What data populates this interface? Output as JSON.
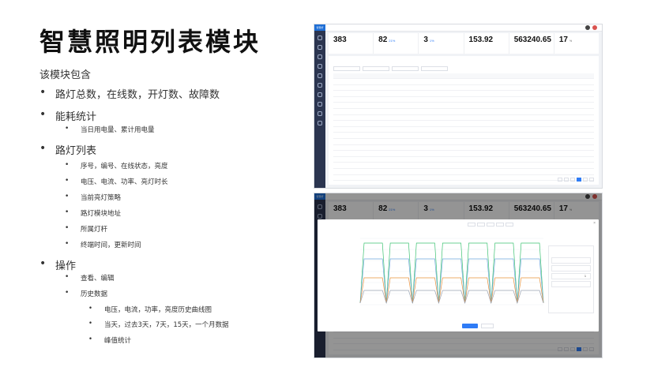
{
  "page": {
    "title": "智慧照明列表模块",
    "intro": "该模块包含"
  },
  "outline": [
    {
      "level": 1,
      "text": "路灯总数，在线数，开灯数、故障数"
    },
    {
      "level": 1,
      "text": "能耗统计"
    },
    {
      "level": 2,
      "text": "当日用电量、累计用电量"
    },
    {
      "level": 1,
      "text": "路灯列表"
    },
    {
      "level": 2,
      "text": "序号，编号、在线状态，亮度"
    },
    {
      "level": 2,
      "text": "电压、电流、功率、亮灯时长"
    },
    {
      "level": 2,
      "text": "当前亮灯策略"
    },
    {
      "level": 2,
      "text": "路灯模块地址"
    },
    {
      "level": 2,
      "text": "所属灯杆"
    },
    {
      "level": 2,
      "text": "终端时间，更新时间"
    },
    {
      "level": 1,
      "text": "操作"
    },
    {
      "level": 2,
      "text": "查看、编辑"
    },
    {
      "level": 2,
      "text": "历史数据"
    },
    {
      "level": 3,
      "text": "电压，电流，功率，亮度历史曲线图"
    },
    {
      "level": 3,
      "text": "当天，过去3天，7天，15天，一个月数据"
    },
    {
      "level": 3,
      "text": "峰值统计"
    }
  ],
  "screens": {
    "logo": "智慧杆",
    "breadcrumb": "",
    "stats": [
      {
        "value": "383",
        "pct": "",
        "unit": "",
        "label": ""
      },
      {
        "value": "82",
        "pct": "21%",
        "unit": "",
        "label": ""
      },
      {
        "value": "3",
        "pct": "1%",
        "unit": "",
        "label": ""
      },
      {
        "value": "153.92",
        "pct": "",
        "unit": "",
        "label": ""
      },
      {
        "value": "563240.65",
        "pct": "",
        "unit": "",
        "label": ""
      },
      {
        "value": "17",
        "pct": "",
        "unit": "%",
        "label": ""
      }
    ],
    "list_title": "",
    "list_time": "",
    "filters": [
      "",
      "",
      "",
      ""
    ],
    "export_label": "",
    "table": {
      "headers": [
        "",
        "",
        "",
        "",
        "",
        "",
        "",
        "",
        "",
        "",
        "",
        "",
        "",
        "",
        ""
      ],
      "rows": [
        [
          "",
          "",
          "",
          "",
          "",
          "",
          "",
          "",
          "",
          "",
          "",
          "",
          "",
          "",
          ""
        ],
        [
          "",
          "",
          "",
          "",
          "",
          "",
          "",
          "",
          "",
          "",
          "",
          "",
          "",
          "",
          ""
        ],
        [
          "",
          "",
          "",
          "",
          "",
          "",
          "",
          "",
          "",
          "",
          "",
          "",
          "",
          "",
          ""
        ],
        [
          "",
          "",
          "",
          "",
          "",
          "",
          "",
          "",
          "",
          "",
          "",
          "",
          "",
          "",
          ""
        ],
        [
          "",
          "",
          "",
          "",
          "",
          "",
          "",
          "",
          "",
          "",
          "",
          "",
          "",
          "",
          ""
        ],
        [
          "",
          "",
          "",
          "",
          "",
          "",
          "",
          "",
          "",
          "",
          "",
          "",
          "",
          "",
          ""
        ],
        [
          "",
          "",
          "",
          "",
          "",
          "",
          "",
          "",
          "",
          "",
          "",
          "",
          "",
          "",
          ""
        ],
        [
          "",
          "",
          "",
          "",
          "",
          "",
          "",
          "",
          "",
          "",
          "",
          "",
          "",
          "",
          ""
        ],
        [
          "",
          "",
          "",
          "",
          "",
          "",
          "",
          "",
          "",
          "",
          "",
          "",
          "",
          "",
          ""
        ],
        [
          "",
          "",
          "",
          "",
          "",
          "",
          "",
          "",
          "",
          "",
          "",
          "",
          "",
          "",
          ""
        ],
        [
          "",
          "",
          "",
          "",
          "",
          "",
          "",
          "",
          "",
          "",
          "",
          "",
          "",
          "",
          ""
        ],
        [
          "",
          "",
          "",
          "",
          "",
          "",
          "",
          "",
          "",
          "",
          "",
          "",
          "",
          "",
          ""
        ],
        [
          "",
          "",
          "",
          "",
          "",
          "",
          "",
          "",
          "",
          "",
          "",
          "",
          "",
          "",
          ""
        ],
        [
          "",
          "",
          "",
          "",
          "",
          "",
          "",
          "",
          "",
          "",
          "",
          "",
          "",
          "",
          ""
        ],
        [
          "",
          "",
          "",
          "",
          "",
          "",
          "",
          "",
          "",
          "",
          "",
          "",
          "",
          "",
          ""
        ],
        [
          "",
          "",
          "",
          "",
          "",
          "",
          "",
          "",
          "",
          "",
          "",
          "",
          "",
          "",
          ""
        ],
        [
          "",
          "",
          "",
          "",
          "",
          "",
          "",
          "",
          "",
          "",
          "",
          "",
          "",
          "",
          ""
        ],
        [
          "",
          "",
          "",
          "",
          "",
          "",
          "",
          "",
          "",
          "",
          "",
          "",
          "",
          "",
          ""
        ],
        [
          "",
          "",
          "",
          "",
          "",
          "",
          "",
          "",
          "",
          "",
          "",
          "",
          "",
          "",
          ""
        ],
        [
          "",
          "",
          "",
          "",
          "",
          "",
          "",
          "",
          "",
          "",
          "",
          "",
          "",
          "",
          ""
        ],
        [
          "",
          "",
          "",
          "",
          "",
          "",
          "",
          "",
          "",
          "",
          "",
          "",
          "",
          "",
          ""
        ],
        [
          "",
          "",
          "",
          "",
          "",
          "",
          "",
          "",
          "",
          "",
          "",
          "",
          "",
          "",
          ""
        ]
      ]
    },
    "pager": {
      "total": "",
      "pages": [
        "",
        "",
        "",
        "",
        "",
        ""
      ],
      "active_index": 3
    },
    "modal": {
      "title": "",
      "close": "×",
      "side_header": "",
      "side_items": [
        "",
        "",
        "",
        "",
        "",
        "",
        "",
        "",
        "",
        ""
      ],
      "range_buttons": [
        "",
        "",
        "",
        "",
        ""
      ],
      "check_label": "",
      "peaks": [
        {
          "label": "",
          "value": ""
        },
        {
          "label": "",
          "value": ""
        },
        {
          "label": "",
          "value": "1"
        },
        {
          "label": "",
          "value": ""
        }
      ],
      "count_label": "",
      "ok_label": "",
      "cancel_label": ""
    },
    "colors": {
      "accent": "#2f7cf6",
      "sidebar": "#2b3550",
      "green": "#52c41a",
      "series": [
        "#3ec373",
        "#6fa8dc",
        "#e8913a",
        "#9aa3b2"
      ]
    }
  }
}
